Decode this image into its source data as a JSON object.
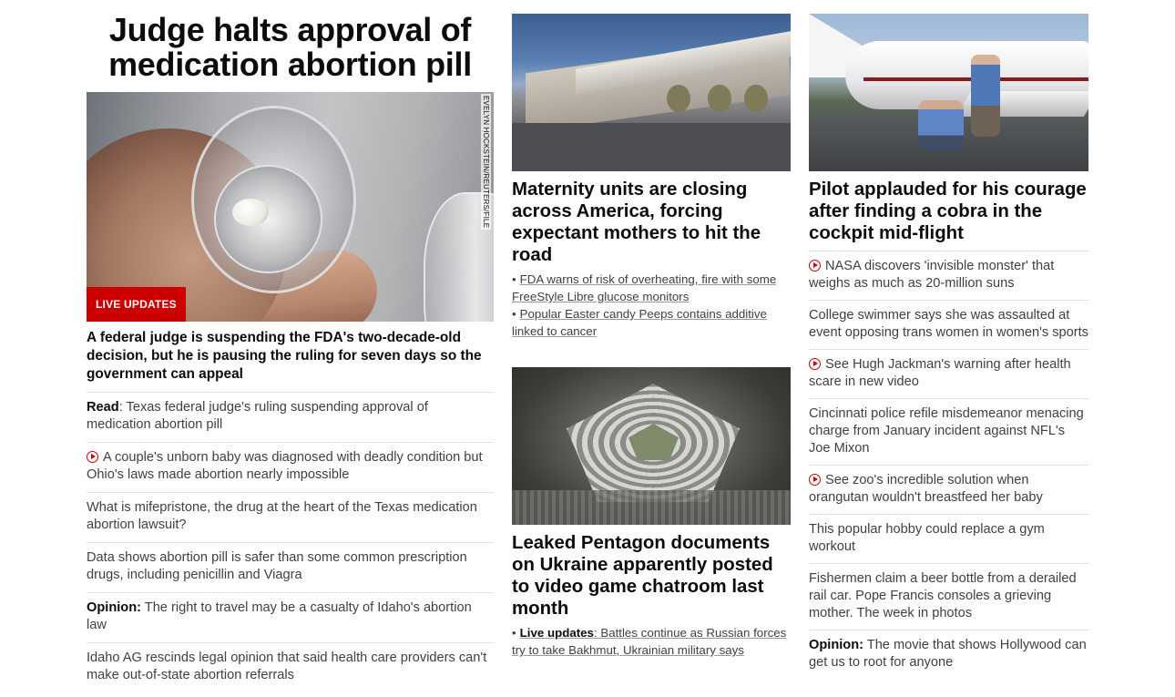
{
  "left": {
    "title": "Judge halts approval of medication abortion pill",
    "image_credit": "EVELYN HOCKSTEIN/REUTERS/FILE",
    "badge": "LIVE UPDATES",
    "lead": "A federal judge is suspending the FDA's two-decade-old decision, but he is pausing the ruling for seven days so the government can appeal",
    "items": [
      {
        "prefix": "Read",
        "text": ": Texas federal judge's ruling suspending approval of medication abortion pill",
        "video": false
      },
      {
        "prefix": "",
        "text": "A couple's unborn baby was diagnosed with deadly condition but Ohio's laws made abortion nearly impossible",
        "video": true
      },
      {
        "prefix": "",
        "text": "What is mifepristone, the drug at the heart of the Texas medication abortion lawsuit?",
        "video": false
      },
      {
        "prefix": "",
        "text": "Data shows abortion pill is safer than some common prescription drugs, including penicillin and Viagra",
        "video": false
      },
      {
        "prefix": "Opinion:",
        "text": " The right to travel may be a casualty of Idaho's abortion law",
        "video": false
      },
      {
        "prefix": "",
        "text": "Idaho AG rescinds legal opinion that said health care providers can't make out-of-state abortion referrals",
        "video": false
      }
    ]
  },
  "middle": {
    "story1": {
      "headline": "Maternity units are closing across America, forcing expectant mothers to hit the road",
      "subs": [
        "FDA warns of risk of overheating, fire with some FreeStyle Libre glucose monitors",
        "Popular Easter candy Peeps contains additive linked to cancer"
      ]
    },
    "story2": {
      "headline": "Leaked Pentagon documents on Ukraine apparently posted to video game chatroom last month",
      "sub_prefix": "Live updates",
      "sub_text": ": Battles continue as Russian forces try to take Bakhmut, Ukrainian military says"
    }
  },
  "right": {
    "headline": "Pilot applauded for his courage after finding a cobra in the cockpit mid-flight",
    "items": [
      {
        "prefix": "",
        "text": "NASA discovers 'invisible monster' that weighs as much as 20-million suns",
        "video": true
      },
      {
        "prefix": "",
        "text": "College swimmer says she was assaulted at event opposing trans women in women's sports",
        "video": false
      },
      {
        "prefix": "",
        "text": "See Hugh Jackman's warning after health scare in new video",
        "video": true
      },
      {
        "prefix": "",
        "text": "Cincinnati police refile misdemeanor menacing charge from January incident against NFL's Joe Mixon",
        "video": false
      },
      {
        "prefix": "",
        "text": "See zoo's incredible solution when orangutan wouldn't breastfeed her baby",
        "video": true
      },
      {
        "prefix": "",
        "text": "This popular hobby could replace a gym workout",
        "video": false
      },
      {
        "prefix": "",
        "text": "Fishermen claim a beer bottle from a derailed rail car. Pope Francis consoles a grieving mother. The week in photos",
        "video": false
      },
      {
        "prefix": "Opinion:",
        "text": " The movie that shows Hollywood can get us to root for anyone",
        "video": false
      }
    ]
  },
  "colors": {
    "accent_red": "#cc0000",
    "text_primary": "#0c0c0c",
    "text_secondary": "#404040",
    "divider": "#e2e2e2"
  }
}
